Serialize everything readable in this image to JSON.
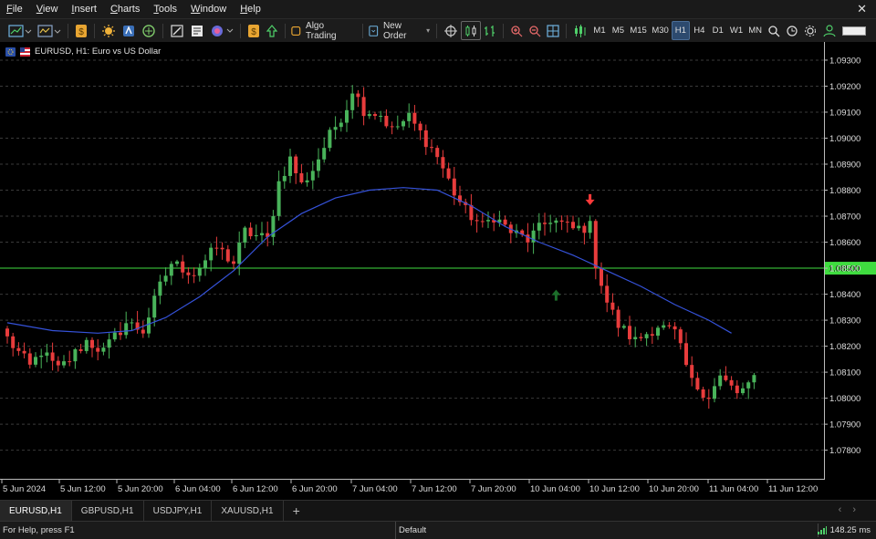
{
  "menu": [
    {
      "label": "File",
      "key": "F",
      "rest": "ile"
    },
    {
      "label": "View",
      "key": "V",
      "rest": "iew"
    },
    {
      "label": "Insert",
      "key": "I",
      "rest": "nsert"
    },
    {
      "label": "Charts",
      "key": "C",
      "rest": "harts"
    },
    {
      "label": "Tools",
      "key": "T",
      "rest": "ools"
    },
    {
      "label": "Window",
      "key": "W",
      "rest": "indow"
    },
    {
      "label": "Help",
      "key": "H",
      "rest": "elp"
    }
  ],
  "toolbar": {
    "algo_trading": "Algo Trading",
    "new_order": "New Order",
    "timeframes": [
      "M1",
      "M5",
      "M15",
      "M30",
      "H1",
      "H4",
      "D1",
      "W1",
      "MN"
    ],
    "active_timeframe": "H1"
  },
  "chart": {
    "symbol_title": "EURUSD, H1:  Euro vs US Dollar",
    "price_line_label": "1.08500",
    "colors": {
      "bull": "#49b35a",
      "bear": "#e83c3c",
      "ma": "#3552d9",
      "hline": "#3fdc3f",
      "grid": "#3a3a3a",
      "buy_arrow": "#1c6e2a",
      "sell_arrow": "#ff3a3a"
    }
  },
  "chart_data": {
    "type": "candlestick",
    "symbol": "EURUSD",
    "timeframe": "H1",
    "ylim": [
      1.0769,
      1.0937
    ],
    "y_ticks": [
      "1.07800",
      "1.07900",
      "1.08000",
      "1.08100",
      "1.08200",
      "1.08300",
      "1.08400",
      "1.08500",
      "1.08600",
      "1.08700",
      "1.08800",
      "1.08900",
      "1.09000",
      "1.09100",
      "1.09200",
      "1.09300"
    ],
    "x_ticks": [
      "5 Jun 2024",
      "5 Jun 12:00",
      "5 Jun 20:00",
      "6 Jun 04:00",
      "6 Jun 12:00",
      "6 Jun 20:00",
      "7 Jun 04:00",
      "7 Jun 12:00",
      "7 Jun 20:00",
      "10 Jun 04:00",
      "10 Jun 12:00",
      "10 Jun 20:00",
      "11 Jun 04:00",
      "11 Jun 12:00"
    ],
    "horizontal_line": 1.085,
    "close_path": [
      [
        0,
        1.0823
      ],
      [
        4,
        1.0812
      ],
      [
        6,
        1.0818
      ],
      [
        9,
        1.0811
      ],
      [
        11,
        1.0815
      ],
      [
        14,
        1.0822
      ],
      [
        17,
        1.0818
      ],
      [
        21,
        1.0829
      ],
      [
        24,
        1.0826
      ],
      [
        27,
        1.0843
      ],
      [
        29,
        1.0852
      ],
      [
        33,
        1.0848
      ],
      [
        37,
        1.0858
      ],
      [
        40,
        1.0852
      ],
      [
        42,
        1.0864
      ],
      [
        46,
        1.0861
      ],
      [
        48,
        1.0883
      ],
      [
        50,
        1.0892
      ],
      [
        52,
        1.0882
      ],
      [
        54,
        1.0888
      ],
      [
        57,
        1.0901
      ],
      [
        60,
        1.0912
      ],
      [
        61,
        1.0919
      ],
      [
        63,
        1.0911
      ],
      [
        66,
        1.0909
      ],
      [
        68,
        1.0903
      ],
      [
        71,
        1.0908
      ],
      [
        74,
        1.0899
      ],
      [
        76,
        1.0893
      ],
      [
        79,
        1.0879
      ],
      [
        81,
        1.0872
      ],
      [
        84,
        1.0866
      ],
      [
        86,
        1.087
      ],
      [
        89,
        1.0864
      ],
      [
        92,
        1.0861
      ],
      [
        96,
        1.0869
      ],
      [
        100,
        1.0865
      ],
      [
        103,
        1.0866
      ],
      [
        104,
        1.0852
      ],
      [
        106,
        1.0837
      ],
      [
        108,
        1.0828
      ],
      [
        111,
        1.0822
      ],
      [
        115,
        1.0828
      ],
      [
        118,
        1.0825
      ],
      [
        121,
        1.0806
      ],
      [
        124,
        1.0801
      ],
      [
        126,
        1.0808
      ],
      [
        129,
        1.0802
      ],
      [
        131,
        1.0804
      ],
      [
        132,
        1.0808
      ]
    ],
    "moving_average": [
      [
        0,
        1.0829
      ],
      [
        8,
        1.0826
      ],
      [
        16,
        1.0825
      ],
      [
        22,
        1.0826
      ],
      [
        28,
        1.0831
      ],
      [
        34,
        1.0839
      ],
      [
        40,
        1.0849
      ],
      [
        46,
        1.0862
      ],
      [
        52,
        1.0871
      ],
      [
        58,
        1.0877
      ],
      [
        64,
        1.088
      ],
      [
        70,
        1.0881
      ],
      [
        76,
        1.088
      ],
      [
        82,
        1.0874
      ],
      [
        88,
        1.0866
      ],
      [
        94,
        1.086
      ],
      [
        100,
        1.0855
      ],
      [
        106,
        1.0849
      ],
      [
        112,
        1.0843
      ],
      [
        118,
        1.0836
      ],
      [
        124,
        1.083
      ],
      [
        128,
        1.0825
      ]
    ],
    "signals": [
      {
        "type": "sell",
        "bar": 103,
        "price": 1.0876
      },
      {
        "type": "buy",
        "bar": 97,
        "price": 1.084
      }
    ]
  },
  "tabs": [
    "EURUSD,H1",
    "GBPUSD,H1",
    "USDJPY,H1",
    "XAUUSD,H1"
  ],
  "active_tab": "EURUSD,H1",
  "tab_add": "+",
  "status": {
    "help": "For Help, press F1",
    "profile": "Default",
    "ping": "148.25 ms"
  }
}
